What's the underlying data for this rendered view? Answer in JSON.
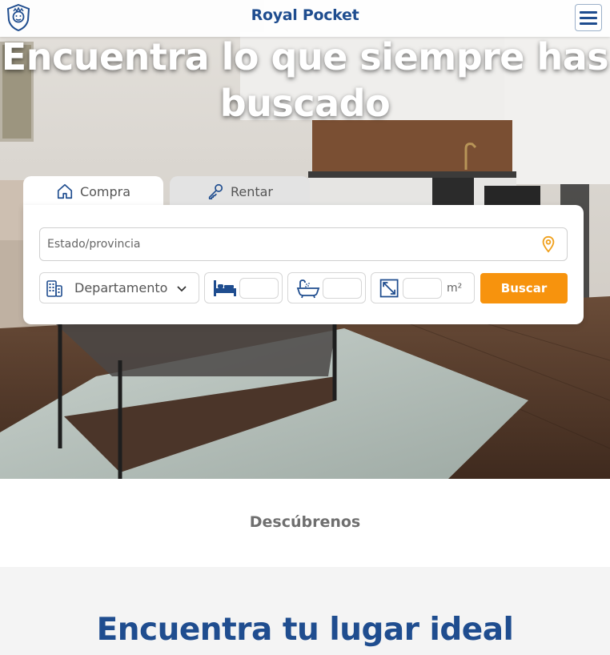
{
  "header": {
    "brand": "Royal Pocket",
    "logo_icon": "lion-shield-icon",
    "menu_icon": "hamburger-icon"
  },
  "hero": {
    "title": "Encuentra lo que siempre has buscado"
  },
  "search": {
    "tabs": [
      {
        "label": "Compra",
        "icon": "house-icon",
        "active": true
      },
      {
        "label": "Rentar",
        "icon": "key-icon",
        "active": false
      }
    ],
    "location_placeholder": "Estado/provincia",
    "location_icon": "map-pin-icon",
    "property_type": "Departamento",
    "bedrooms_value": "",
    "bathrooms_value": "",
    "area_value": "",
    "area_unit": "m²",
    "submit_label": "Buscar"
  },
  "sections": {
    "discover_label": "Descúbrenos",
    "ideal_title": "Encuentra tu lugar ideal"
  },
  "colors": {
    "brand_blue": "#1f4d8f",
    "accent_orange": "#f7930d",
    "pin_orange": "#f0a01c"
  }
}
